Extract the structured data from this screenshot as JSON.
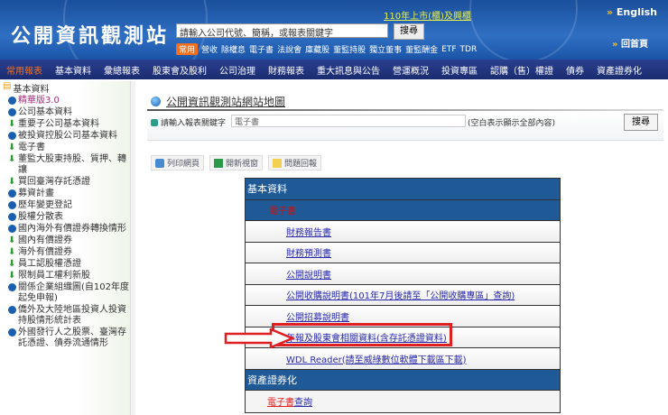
{
  "header": {
    "logo": "公開資訊觀測站",
    "search_placeholder": "請輸入公司代號、簡稱，或報表關鍵字",
    "search_button": "搜尋",
    "notice": "110年上市(櫃)及興櫃",
    "quick_tag": "常用",
    "quick_links": [
      "營收",
      "除權息",
      "電子書",
      "法說會",
      "庫藏股",
      "董監持股",
      "獨立董事",
      "董監酬金",
      "ETF",
      "TDR"
    ],
    "english": "English",
    "home": "回首頁"
  },
  "nav": [
    "常用報表",
    "基本資料",
    "彙總報表",
    "股東會及股利",
    "公司治理",
    "財務報表",
    "重大訊息與公告",
    "營運概況",
    "投資專區",
    "認購（售）權證",
    "債券",
    "資產證券化"
  ],
  "sidebar": {
    "root": "基本資料",
    "items": [
      {
        "label": "精華版3.0",
        "icon": "circle",
        "color": "#a0307a"
      },
      {
        "label": "公司基本資料",
        "icon": "circle"
      },
      {
        "label": "重要子公司基本資料",
        "icon": "download"
      },
      {
        "label": "被投資控股公司基本資料",
        "icon": "circle"
      },
      {
        "label": "電子書",
        "icon": "download"
      },
      {
        "label": "董監大股東持股、質押、轉讓",
        "icon": "download"
      },
      {
        "label": "買回臺灣存託憑證",
        "icon": "download"
      },
      {
        "label": "募資計畫",
        "icon": "circle"
      },
      {
        "label": "歷年變更登記",
        "icon": "circle"
      },
      {
        "label": "股權分散表",
        "icon": "circle"
      },
      {
        "label": "國內海外有價證券轉換情形",
        "icon": "circle"
      },
      {
        "label": "國內有價證券",
        "icon": "download"
      },
      {
        "label": "海外有價證券",
        "icon": "download"
      },
      {
        "label": "員工認股權憑證",
        "icon": "download"
      },
      {
        "label": "限制員工權利新股",
        "icon": "download"
      },
      {
        "label": "關係企業組織圖(自102年度起免申報)",
        "icon": "circle"
      },
      {
        "label": "僑外及大陸地區投資人投資持股情形統計表",
        "icon": "circle"
      },
      {
        "label": "外國發行人之股票、臺灣存託憑證、債券流通情形",
        "icon": "circle"
      }
    ]
  },
  "main": {
    "title": "公開資訊觀測站網站地圖",
    "search_label": "請輸入報表關鍵字",
    "search_value": "電子書",
    "search_hint": "(空白表示顯示全部內容)",
    "search_button": "搜尋",
    "tools": [
      "列印網頁",
      "開新視窗",
      "問題回報"
    ],
    "table": {
      "cat1": "基本資料",
      "sub1": "電子書",
      "links": [
        "財務報告書",
        "財務預測書",
        "公開說明書",
        "公開收購說明書(101年7月後請至「公開收購專區」查詢)",
        "公開招募說明書",
        "年報及股東會相關資料(含存託憑證資料)",
        "WDL Reader(請至威綠數位軟體下載區下載)"
      ],
      "cat2": "資產證券化",
      "last_red": "電子書",
      "last_blue": "查詢"
    }
  }
}
